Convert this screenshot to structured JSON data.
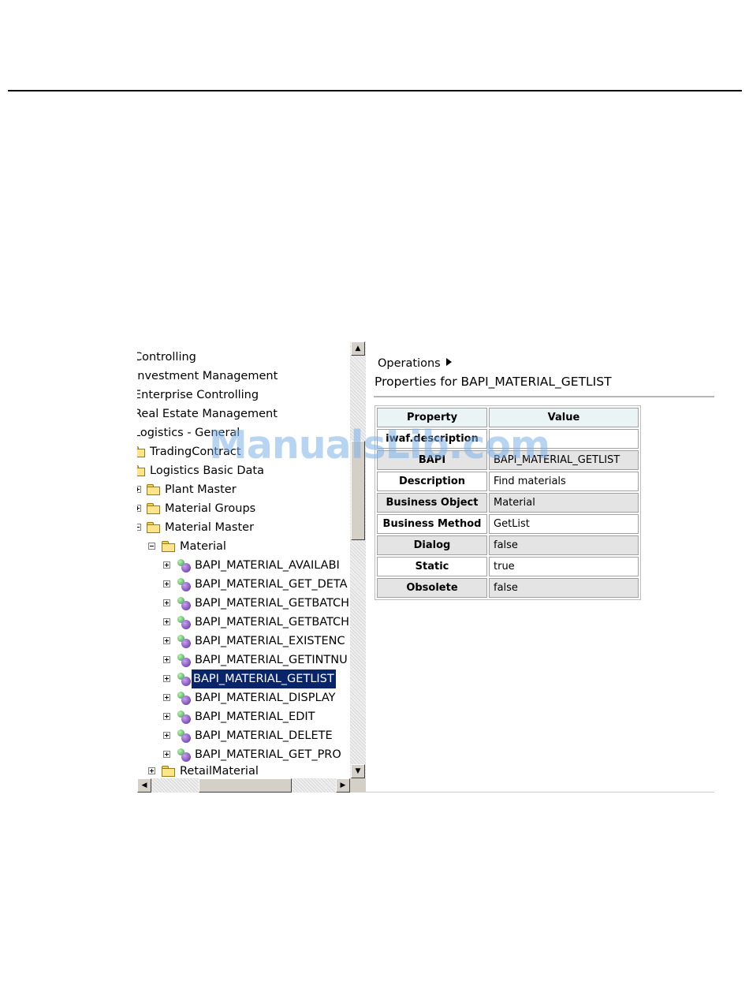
{
  "watermark": "ManualsLib.com",
  "tree": {
    "rows": [
      {
        "label": "Controlling",
        "icon": "none"
      },
      {
        "label": "Investment Management",
        "icon": "none"
      },
      {
        "label": "Enterprise Controlling",
        "icon": "none"
      },
      {
        "label": "Real Estate Management",
        "icon": "none"
      },
      {
        "label": "Logistics - General",
        "icon": "none"
      },
      {
        "label": "TradingContract",
        "icon": "folder-icon"
      },
      {
        "label": "Logistics Basic Data",
        "icon": "folder-icon"
      },
      {
        "label": "Plant Master",
        "icon": "folder-icon"
      },
      {
        "label": "Material Groups",
        "icon": "folder-icon"
      },
      {
        "label": "Material Master",
        "icon": "folder-icon"
      },
      {
        "label": "Material",
        "icon": "folder-icon"
      },
      {
        "label": "BAPI_MATERIAL_AVAILABI",
        "icon": "bapi-method-icon"
      },
      {
        "label": "BAPI_MATERIAL_GET_DETA",
        "icon": "bapi-method-icon"
      },
      {
        "label": "BAPI_MATERIAL_GETBATCH",
        "icon": "bapi-method-icon"
      },
      {
        "label": "BAPI_MATERIAL_GETBATCH",
        "icon": "bapi-method-icon"
      },
      {
        "label": "BAPI_MATERIAL_EXISTENC",
        "icon": "bapi-method-icon"
      },
      {
        "label": "BAPI_MATERIAL_GETINTNU",
        "icon": "bapi-method-icon"
      },
      {
        "label": "BAPI_MATERIAL_GETLIST",
        "icon": "bapi-method-icon",
        "selected": true
      },
      {
        "label": "BAPI_MATERIAL_DISPLAY",
        "icon": "bapi-method-icon"
      },
      {
        "label": "BAPI_MATERIAL_EDIT",
        "icon": "bapi-method-icon"
      },
      {
        "label": "BAPI_MATERIAL_DELETE",
        "icon": "bapi-method-icon"
      },
      {
        "label": "BAPI_MATERIAL_GET_PRO",
        "icon": "bapi-method-icon"
      },
      {
        "label": "RetailMaterial",
        "icon": "folder-icon"
      }
    ]
  },
  "properties": {
    "breadcrumb": "Operations",
    "title": "Properties for BAPI_MATERIAL_GETLIST",
    "header": {
      "property": "Property",
      "value": "Value"
    },
    "rows": [
      {
        "property": "iwaf.description",
        "value": ""
      },
      {
        "property": "BAPI",
        "value": "BAPI_MATERIAL_GETLIST"
      },
      {
        "property": "Description",
        "value": "Find materials"
      },
      {
        "property": "Business Object",
        "value": "Material"
      },
      {
        "property": "Business Method",
        "value": "GetList"
      },
      {
        "property": "Dialog",
        "value": "false"
      },
      {
        "property": "Static",
        "value": "true"
      },
      {
        "property": "Obsolete",
        "value": "false"
      }
    ]
  },
  "colors": {
    "selection": "#0a246a",
    "header_bg": "#eaf4f4",
    "alt_row_bg": "#e4e4e4"
  }
}
